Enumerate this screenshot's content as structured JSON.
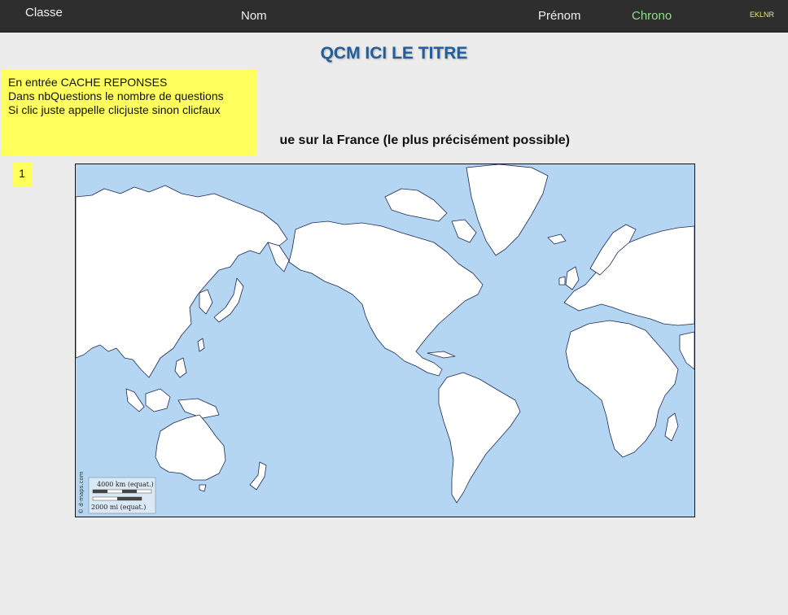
{
  "topbar": {
    "classe": "Classe",
    "nom": "Nom",
    "prenom": "Prénom",
    "chrono": "Chrono",
    "code": "EKLNR"
  },
  "title": "QCM ICI LE TITRE",
  "note": {
    "line1": "En entrée CACHE REPONSES",
    "line2": "Dans nbQuestions le nombre de questions",
    "line3": "Si clic juste appelle clicjuste sinon clicfaux"
  },
  "question_text": "ue sur la France (le plus précisément possible)",
  "question_number": "1",
  "map": {
    "credit": "© d-maps.com",
    "scale_km": "4000 km (equat.)",
    "scale_mi": "2000 mi (equat.)",
    "colors": {
      "ocean": "#b4d6f3",
      "land": "#ffffff",
      "border": "#1b2a55"
    }
  }
}
